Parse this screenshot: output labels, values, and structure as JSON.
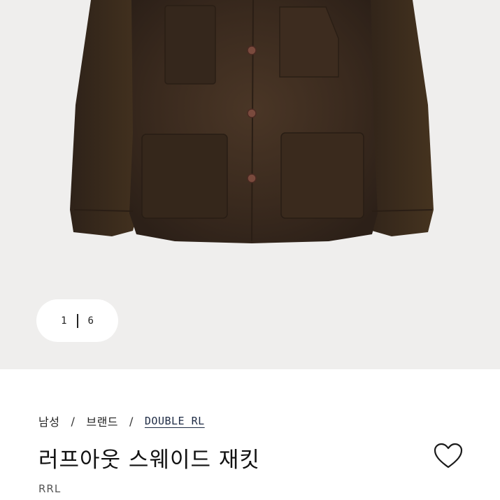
{
  "gallery": {
    "current": "1",
    "total": "6"
  },
  "breadcrumb": {
    "items": [
      "남성",
      "브랜드",
      "DOUBLE RL"
    ],
    "separator": "/"
  },
  "product": {
    "title": "러프아웃 스웨이드 재킷",
    "brand": "RRL"
  },
  "icons": {
    "wishlist": "heart-outline-icon"
  },
  "colors": {
    "background": "#efeeed",
    "jacket": "#3b2a1f",
    "button": "#7a4a3d"
  }
}
